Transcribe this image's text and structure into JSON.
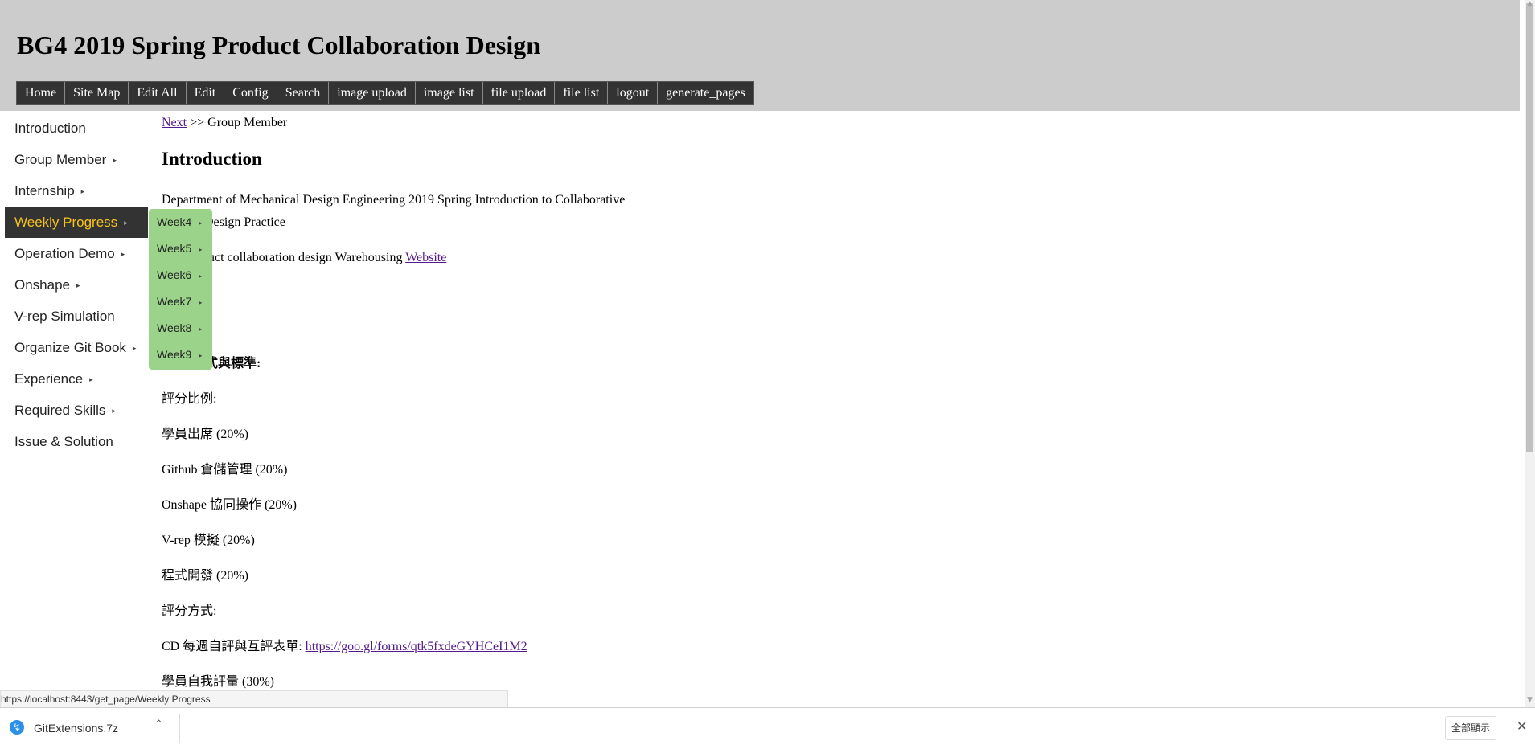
{
  "header": {
    "title": "BG4 2019 Spring Product Collaboration Design",
    "nav": [
      "Home",
      "Site Map",
      "Edit All",
      "Edit",
      "Config",
      "Search",
      "image upload",
      "image list",
      "file upload",
      "file list",
      "logout",
      "generate_pages"
    ]
  },
  "sidebar": {
    "items": [
      {
        "label": "Introduction",
        "has_submenu": false
      },
      {
        "label": "Group Member",
        "has_submenu": true
      },
      {
        "label": "Internship",
        "has_submenu": true
      },
      {
        "label": "Weekly Progress",
        "has_submenu": true,
        "active": true
      },
      {
        "label": "Operation Demo",
        "has_submenu": true
      },
      {
        "label": "Onshape",
        "has_submenu": true
      },
      {
        "label": "V-rep Simulation",
        "has_submenu": false
      },
      {
        "label": "Organize Git Book",
        "has_submenu": true
      },
      {
        "label": "Experience",
        "has_submenu": true
      },
      {
        "label": "Required Skills",
        "has_submenu": true
      },
      {
        "label": "Issue & Solution",
        "has_submenu": false
      }
    ],
    "submenu": [
      "Week4",
      "Week5",
      "Week6",
      "Week7",
      "Week8",
      "Week9"
    ]
  },
  "content": {
    "breadcrumb_link": "Next",
    "breadcrumb_rest": ">> Group Member",
    "heading": "Introduction",
    "line1": "Department of Mechanical Design Engineering 2019 Spring Introduction to Collaborative",
    "line2_visible": "Design Practice",
    "line3_visible": "uct collaboration design Warehousing",
    "website_link": "Website",
    "section_visible": "式與標準:",
    "grading_ratio": "評分比例:",
    "attendance": "學員出席 (20%)",
    "github": "Github 倉儲管理  (20%)",
    "onshape": "Onshape 協同操作 (20%)",
    "vrep": "V-rep 模擬 (20%)",
    "programming": "程式開發 (20%)",
    "grading_method": "評分方式:",
    "cd_form_label": "CD 每週自評與互評表單:",
    "cd_form_link": "https://goo.gl/forms/qtk5fxdeGYHCeI1M2",
    "self_eval": "學員自我評量 (30%)"
  },
  "status": {
    "url": "https://localhost:8443/get_page/Weekly Progress"
  },
  "downloads": {
    "file_name": "GitExtensions.7z",
    "show_all": "全部顯示"
  }
}
